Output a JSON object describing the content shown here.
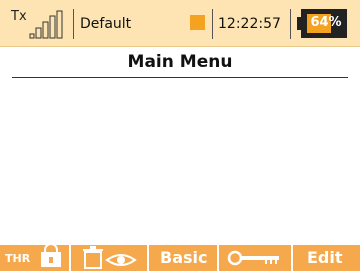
{
  "status_bar": {
    "tx_label": "Tx",
    "model_name": "Default",
    "time": "12:22:57",
    "battery_percent": "64%",
    "battery_level": 0.64,
    "signal_bars_filled": 4,
    "signal_bars_total": 4
  },
  "page": {
    "title": "Main Menu"
  },
  "softkeys": {
    "thr_label": "THR",
    "basic_label": "Basic",
    "edit_label": "Edit"
  },
  "icons": {
    "lock": "lock-icon",
    "signal": "signal-bars-icon",
    "timer": "timer-icon",
    "eye": "eye-icon",
    "key": "key-icon"
  },
  "colors": {
    "status_bar_bg": "#fde4b2",
    "accent_orange": "#f4a21f",
    "softkey_bg": "#f6a84d"
  }
}
